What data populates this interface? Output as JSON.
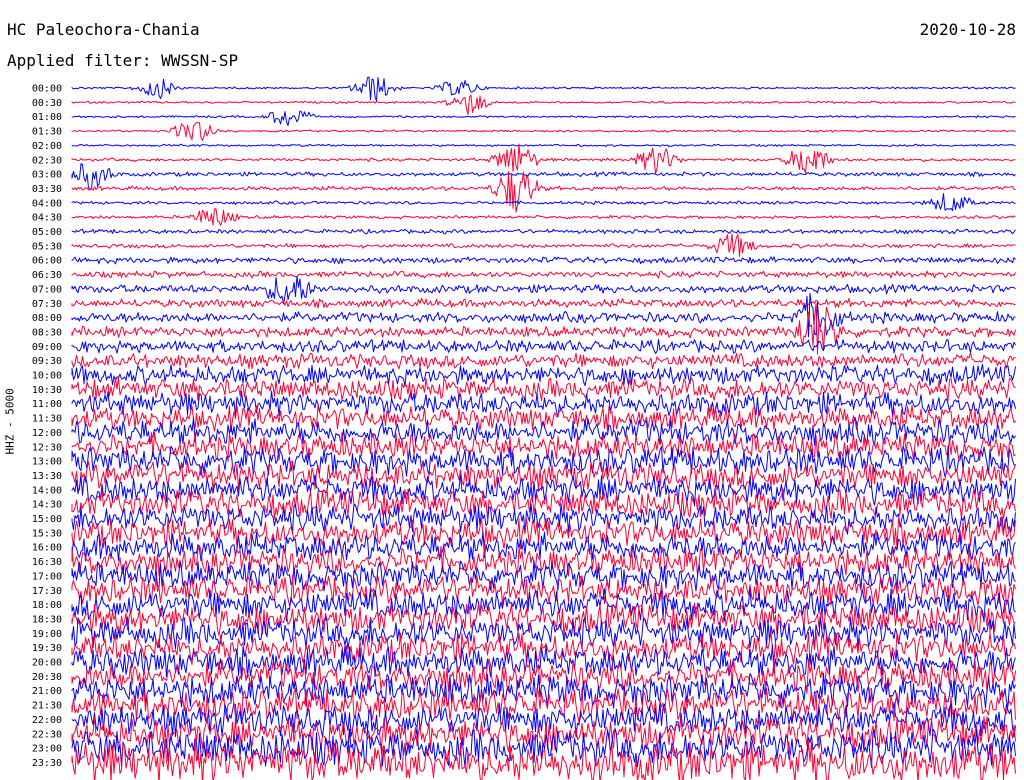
{
  "header": {
    "station": "HC Paleochora-Chania",
    "date": "2020-10-28",
    "filter": "Applied filter: WWSSN-SP",
    "channel": "HHZ - 5000"
  },
  "colors": {
    "trace_a": "#0000ff",
    "trace_b": "#ff0033",
    "background": "#ffffff"
  },
  "chart_data": {
    "type": "line",
    "title": "HC Paleochora-Chania",
    "subtitle": "Applied filter: WWSSN-SP",
    "ylabel": "HHZ - 5000",
    "row_labels": [
      "00:00",
      "00:30",
      "01:00",
      "01:30",
      "02:00",
      "02:30",
      "03:00",
      "03:30",
      "04:00",
      "04:30",
      "05:00",
      "05:30",
      "06:00",
      "06:30",
      "07:00",
      "07:30",
      "08:00",
      "08:30",
      "09:00",
      "09:30",
      "10:00",
      "10:30",
      "11:00",
      "11:30",
      "12:00",
      "12:30",
      "13:00",
      "13:30",
      "14:00",
      "14:30",
      "15:00",
      "15:30",
      "16:00",
      "16:30",
      "17:00",
      "17:30",
      "18:00",
      "18:30",
      "19:00",
      "19:30",
      "20:00",
      "20:30",
      "21:00",
      "21:30",
      "22:00",
      "22:30",
      "23:00",
      "23:30"
    ],
    "series_colors": [
      "#0000ff",
      "#ff0033"
    ],
    "noise_level": [
      1,
      1,
      1,
      1,
      1,
      1.5,
      2,
      2,
      1.5,
      1.5,
      2,
      2,
      3,
      3,
      4,
      4,
      5,
      5,
      6,
      7,
      9,
      10,
      11,
      11,
      12,
      12,
      13,
      13,
      13,
      13,
      13,
      13,
      13,
      13,
      13,
      13,
      14,
      14,
      14,
      14,
      14,
      14,
      15,
      15,
      15,
      15,
      17,
      20
    ],
    "events": [
      {
        "row": 0,
        "x": 0.09,
        "amp": 6
      },
      {
        "row": 0,
        "x": 0.32,
        "amp": 8
      },
      {
        "row": 0,
        "x": 0.41,
        "amp": 5
      },
      {
        "row": 1,
        "x": 0.42,
        "amp": 7
      },
      {
        "row": 2,
        "x": 0.23,
        "amp": 6
      },
      {
        "row": 3,
        "x": 0.13,
        "amp": 7
      },
      {
        "row": 5,
        "x": 0.47,
        "amp": 10
      },
      {
        "row": 5,
        "x": 0.62,
        "amp": 8
      },
      {
        "row": 5,
        "x": 0.78,
        "amp": 10
      },
      {
        "row": 6,
        "x": 0.02,
        "amp": 8
      },
      {
        "row": 7,
        "x": 0.47,
        "amp": 14
      },
      {
        "row": 8,
        "x": 0.93,
        "amp": 6
      },
      {
        "row": 9,
        "x": 0.15,
        "amp": 6
      },
      {
        "row": 11,
        "x": 0.7,
        "amp": 7
      },
      {
        "row": 14,
        "x": 0.23,
        "amp": 10
      },
      {
        "row": 16,
        "x": 0.79,
        "amp": 14
      },
      {
        "row": 17,
        "x": 0.79,
        "amp": 16
      }
    ],
    "grid": false,
    "legend": "none"
  }
}
